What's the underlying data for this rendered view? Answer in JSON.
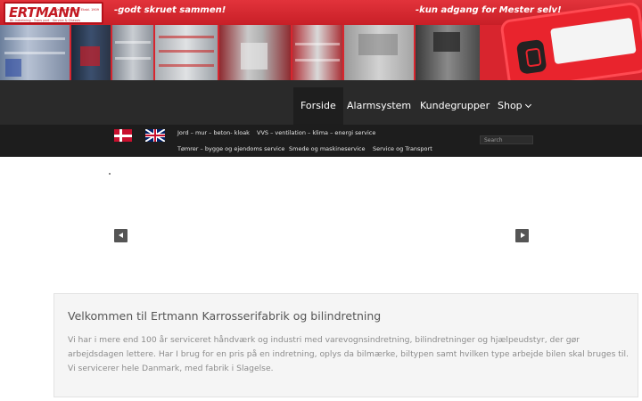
{
  "banner": {
    "logo_text": "ERTMANN",
    "logo_sub": "Bil-indretning · Trans port · Service & Chassis",
    "logo_right": "Karrosserifabrik\nEtabl. 1909",
    "tagline_left": "-godt skruet sammen!",
    "tagline_right": "-kun adgang for Mester selv!",
    "accent_color": "#d8252e"
  },
  "mainnav": {
    "items": [
      {
        "label": "Forside",
        "active": true
      },
      {
        "label": "Alarmsystem",
        "active": false
      },
      {
        "label": "Kundegrupper",
        "active": false
      },
      {
        "label": "Shop",
        "active": false,
        "icon": "chevron-down-icon"
      }
    ]
  },
  "subnav": {
    "flags": [
      "danish-flag-icon",
      "uk-flag-icon"
    ],
    "links": [
      "Jord – mur – beton- kloak",
      "VVS – ventilation – klima – energi service",
      "Tømrer – bygge og ejendoms service",
      "Smede og maskineservice",
      "Service og Transport"
    ],
    "search_placeholder": "Search"
  },
  "slider": {
    "prev_icon": "chevron-left-icon",
    "next_icon": "chevron-right-icon"
  },
  "welcome": {
    "title": "Velkommen til Ertmann Karrosserifabrik og bilindretning",
    "paragraph": "Vi har i mere end 100 år serviceret håndværk og industri med varevognsindretning, bilindretninger og hjælpeudstyr, der gør arbejdsdagen lettere. Har I brug for en pris på en indretning, oplys da bilmærke, biltypen samt hvilken type arbejde bilen skal bruges til. Vi servicerer hele Danmark, med fabrik i Slagelse."
  }
}
